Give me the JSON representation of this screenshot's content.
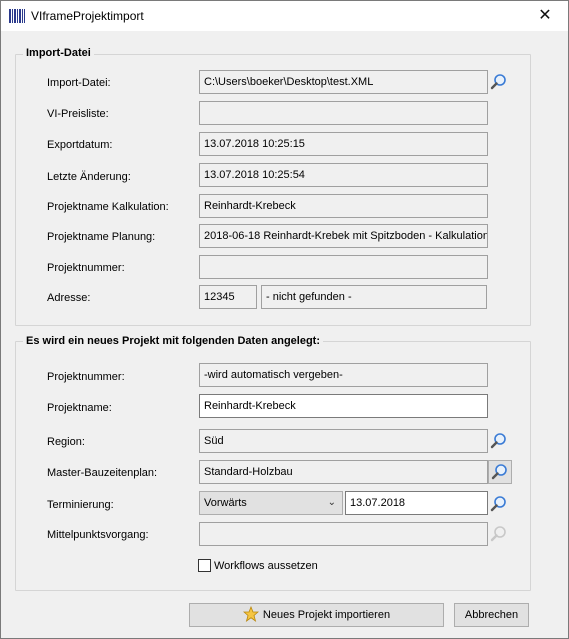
{
  "window": {
    "title": "VIframeProjektimport",
    "close_glyph": "✕"
  },
  "import_group": {
    "title": "Import-Datei",
    "rows": {
      "import_file": {
        "label": "Import-Datei:",
        "value": "C:\\Users\\boeker\\Desktop\\test.XML"
      },
      "price_list": {
        "label": "VI-Preisliste:",
        "value": ""
      },
      "export_date": {
        "label": "Exportdatum:",
        "value": "13.07.2018 10:25:15"
      },
      "last_change": {
        "label": "Letzte Änderung:",
        "value": "13.07.2018 10:25:54"
      },
      "name_calc": {
        "label": "Projektname Kalkulation:",
        "value": "Reinhardt-Krebeck"
      },
      "name_plan": {
        "label": "Projektname Planung:",
        "value": "2018-06-18 Reinhardt-Krebek mit  Spitzboden - Kalkulation."
      },
      "project_number": {
        "label": "Projektnummer:",
        "value": ""
      },
      "address": {
        "label": "Adresse:",
        "zip": "12345",
        "status": "- nicht gefunden -"
      }
    }
  },
  "new_project_group": {
    "title": "Es wird ein neues Projekt mit folgenden Daten angelegt:",
    "rows": {
      "project_number": {
        "label": "Projektnummer:",
        "value": "-wird automatisch vergeben-"
      },
      "project_name": {
        "label": "Projektname:",
        "value": "Reinhardt-Krebeck"
      },
      "region": {
        "label": "Region:",
        "value": "Süd"
      },
      "master_plan": {
        "label": "Master-Bauzeitenplan:",
        "value": "Standard-Holzbau"
      },
      "scheduling": {
        "label": "Terminierung:",
        "mode": "Vorwärts",
        "date": "13.07.2018"
      },
      "midpoint": {
        "label": "Mittelpunktsvorgang:",
        "value": ""
      },
      "workflows": {
        "label": "Workflows aussetzen",
        "checked": false
      }
    }
  },
  "buttons": {
    "import": "Neues Projekt importieren",
    "cancel": "Abbrechen"
  },
  "icons": {
    "app": "barcode-icon",
    "search": "magnifier-icon",
    "star": "star-icon"
  },
  "colors": {
    "star": "#f5c542",
    "magnifier_active": "#3a7bd5",
    "magnifier_disabled": "#c8c8c8"
  }
}
